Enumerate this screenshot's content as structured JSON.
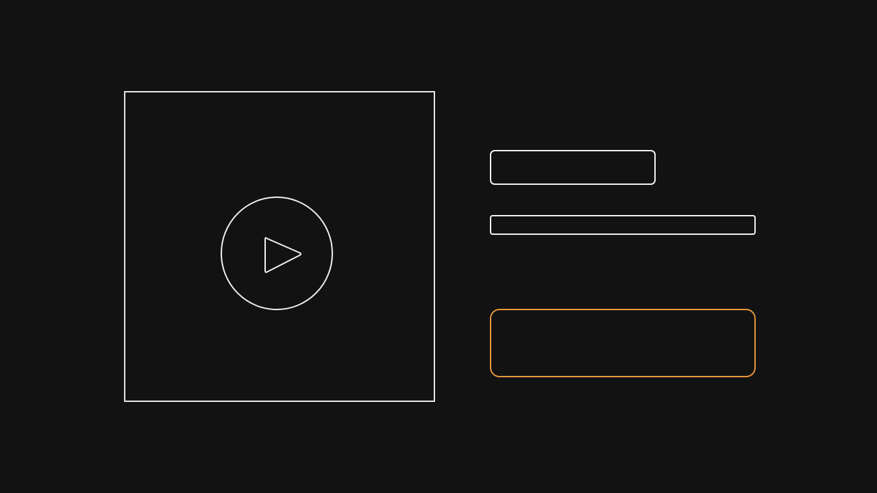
{
  "player": {
    "play_icon": "play-icon"
  },
  "info": {
    "title": "",
    "subtitle": ""
  },
  "action": {
    "label": ""
  },
  "colors": {
    "background": "#121212",
    "outline": "#f2f2f2",
    "accent": "#e8963a"
  }
}
